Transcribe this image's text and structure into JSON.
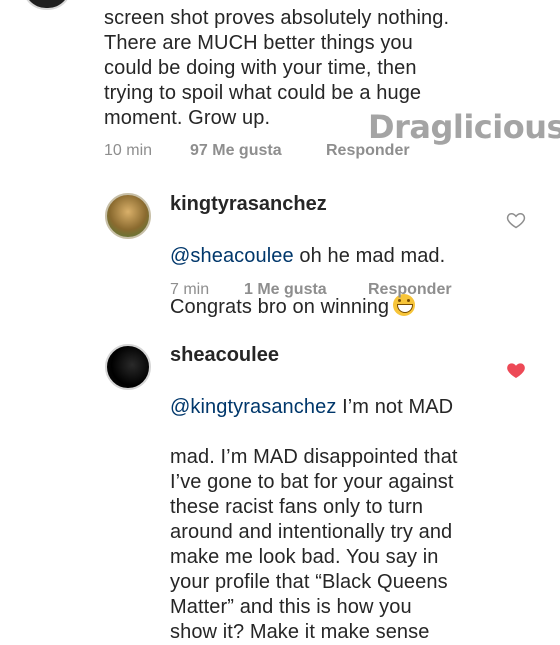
{
  "comment_top": {
    "lines": "screen shot proves absolutely nothing.\nThere are MUCH better things you\ncould be doing with your time, then\ntrying to spoil what could be a huge\nmoment. Grow up.",
    "time": "10 min",
    "likes": "97 Me gusta",
    "reply": "Responder"
  },
  "watermark": "Draglicious",
  "comment_1": {
    "username": "kingtyrasanchez",
    "mention": "@sheacoulee",
    "text_after_mention": " oh he mad mad.",
    "text_line2": "Congrats bro on winning",
    "emoji": "grinning-face-emoji",
    "time": "7 min",
    "likes": "1 Me gusta",
    "reply": "Responder",
    "liked": false
  },
  "comment_2": {
    "username": "sheacoulee",
    "mention": "@kingtyrasanchez",
    "text_after_mention": " I’m not MAD",
    "text_rest": "mad. I’m MAD disappointed that\nI’ve gone to bat for your against\nthese racist fans only to turn\naround and intentionally try and\nmake me look bad. You say in\nyour profile that “Black Queens\nMatter” and this is how you\nshow it? Make it make sense",
    "liked": true,
    "like_color": "#ed4956"
  }
}
